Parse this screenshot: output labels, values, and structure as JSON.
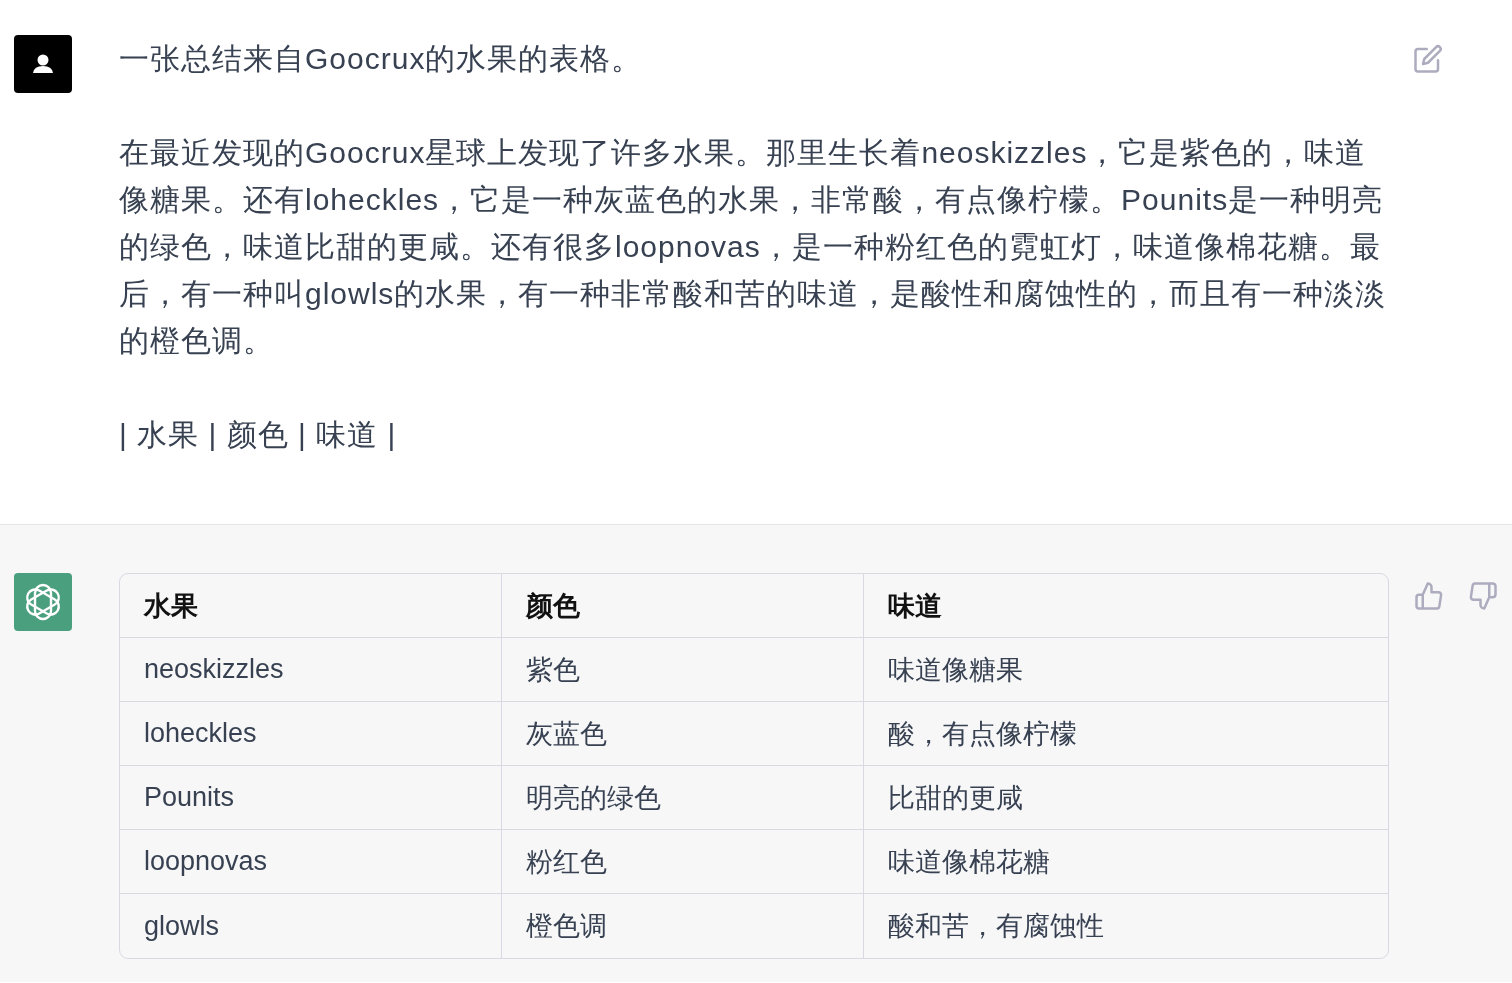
{
  "user_message": {
    "paragraphs": [
      "一张总结来自Goocrux的水果的表格。",
      "在最近发现的Goocrux星球上发现了许多水果。那里生长着neoskizzles，它是紫色的，味道像糖果。还有loheckles，它是一种灰蓝色的水果，非常酸，有点像柠檬。Pounits是一种明亮的绿色，味道比甜的更咸。还有很多loopnovas，是一种粉红色的霓虹灯，味道像棉花糖。最后，有一种叫glowls的水果，有一种非常酸和苦的味道，是酸性和腐蚀性的，而且有一种淡淡的橙色调。",
      "| 水果 | 颜色 | 味道 |"
    ]
  },
  "assistant_message": {
    "table": {
      "columns": [
        "水果",
        "颜色",
        "味道"
      ],
      "rows": [
        [
          "neoskizzles",
          "紫色",
          "味道像糖果"
        ],
        [
          "loheckles",
          "灰蓝色",
          "酸，有点像柠檬"
        ],
        [
          "Pounits",
          "明亮的绿色",
          "比甜的更咸"
        ],
        [
          "loopnovas",
          "粉红色",
          "味道像棉花糖"
        ],
        [
          "glowls",
          "橙色调",
          "酸和苦，有腐蚀性"
        ]
      ]
    }
  }
}
